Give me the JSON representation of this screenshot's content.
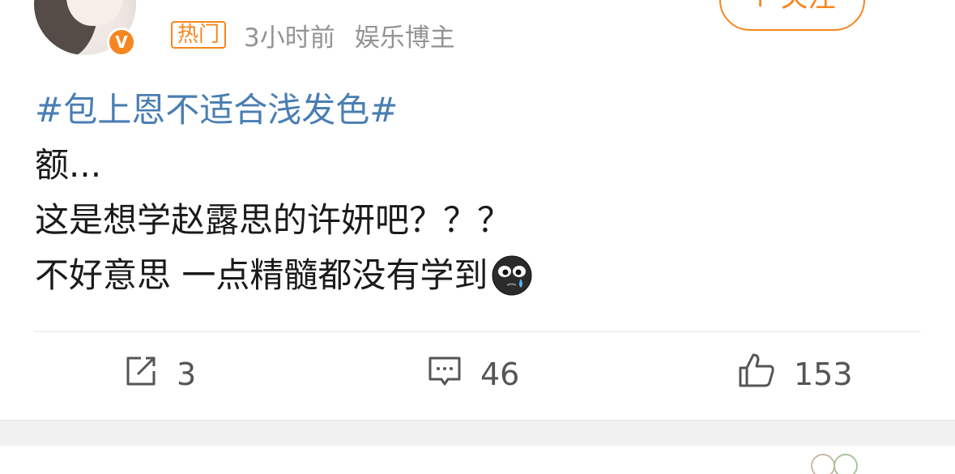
{
  "author": {
    "verified_badge": "V"
  },
  "header": {
    "follow_label": "+ 关注",
    "hot_tag": "热门",
    "time": "3小时前",
    "role": "娱乐博主"
  },
  "post": {
    "hashtag": "#包上恩不适合浅发色#",
    "line1": "额...",
    "line2": "这是想学赵露思的许妍吧？？？",
    "line3": "不好意思 一点精髓都没有学到",
    "emoji": "crying-face-emoji"
  },
  "actions": {
    "repost_icon": "share-icon",
    "repost_count": "3",
    "comment_icon": "comment-icon",
    "comment_count": "46",
    "like_icon": "thumbs-up-icon",
    "like_count": "153"
  },
  "colors": {
    "accent": "#f6861f",
    "hashtag": "#4a7eb3",
    "meta_text": "#939393"
  }
}
